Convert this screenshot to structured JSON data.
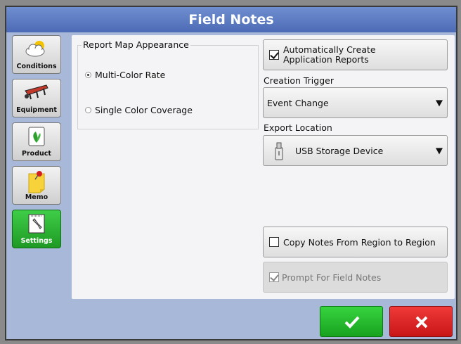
{
  "window": {
    "title": "Field Notes"
  },
  "sidebar": {
    "items": [
      {
        "label": "Conditions",
        "icon": "cloud-icon"
      },
      {
        "label": "Equipment",
        "icon": "plow-icon"
      },
      {
        "label": "Product",
        "icon": "seed-bag-icon"
      },
      {
        "label": "Memo",
        "icon": "memo-pin-icon"
      },
      {
        "label": "Settings",
        "icon": "wrench-icon",
        "active": true
      }
    ]
  },
  "report_map": {
    "title": "Report Map Appearance",
    "options": [
      {
        "label": "Multi-Color Rate",
        "selected": true
      },
      {
        "label": "Single Color Coverage",
        "selected": false
      }
    ]
  },
  "auto_create": {
    "line1": "Automatically Create",
    "line2": "Application Reports",
    "checked": true
  },
  "creation_trigger": {
    "label": "Creation Trigger",
    "value": "Event Change"
  },
  "export_location": {
    "label": "Export Location",
    "value": "USB Storage Device"
  },
  "copy_notes": {
    "label": "Copy Notes From Region to Region",
    "checked": false
  },
  "prompt_notes": {
    "label": "Prompt For Field Notes",
    "checked": true,
    "disabled": true
  },
  "colors": {
    "accept": "#22b02a",
    "cancel": "#d91f1f",
    "title_bar": "#5a7ac2"
  }
}
